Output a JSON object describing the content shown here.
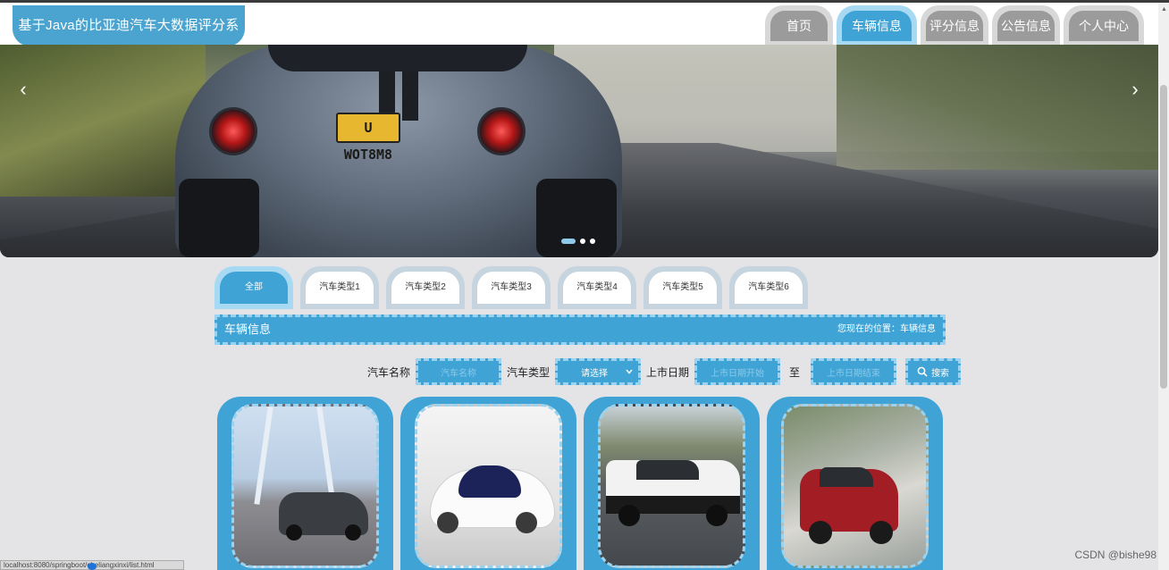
{
  "header": {
    "brand": "基于Java的比亚迪汽车大数据评分系统",
    "nav": [
      {
        "label": "首页"
      },
      {
        "label": "车辆信息",
        "active": true
      },
      {
        "label": "评分信息"
      },
      {
        "label": "公告信息"
      },
      {
        "label": "个人中心"
      }
    ]
  },
  "carousel": {
    "plate": "U WOT8M8",
    "prev_icon": "chevron-left-icon",
    "next_icon": "chevron-right-icon",
    "prev_glyph": "‹",
    "next_glyph": "›",
    "slide_count": 3,
    "active_slide": 1
  },
  "category_tabs": [
    {
      "label": "全部",
      "active": true
    },
    {
      "label": "汽车类型1"
    },
    {
      "label": "汽车类型2"
    },
    {
      "label": "汽车类型3"
    },
    {
      "label": "汽车类型4"
    },
    {
      "label": "汽车类型5"
    },
    {
      "label": "汽车类型6"
    }
  ],
  "section": {
    "title": "车辆信息",
    "breadcrumb": "您现在的位置：车辆信息"
  },
  "search": {
    "name_label": "汽车名称",
    "name_placeholder": "汽车名称",
    "type_label": "汽车类型",
    "type_selected": "请选择",
    "date_label": "上市日期",
    "date_start_placeholder": "上市日期开始",
    "date_to": "至",
    "date_end_placeholder": "上市日期结束",
    "search_button": "搜索",
    "search_icon": "search-icon"
  },
  "status_bar": {
    "url": "localhost:8080/springboot/cheliangxinxi/list.html"
  },
  "watermark": "CSDN @bishe98",
  "colors": {
    "accent": "#3fa3d5",
    "accent_light": "#a7d9f2",
    "nav_inactive": "#9b9b9b"
  }
}
